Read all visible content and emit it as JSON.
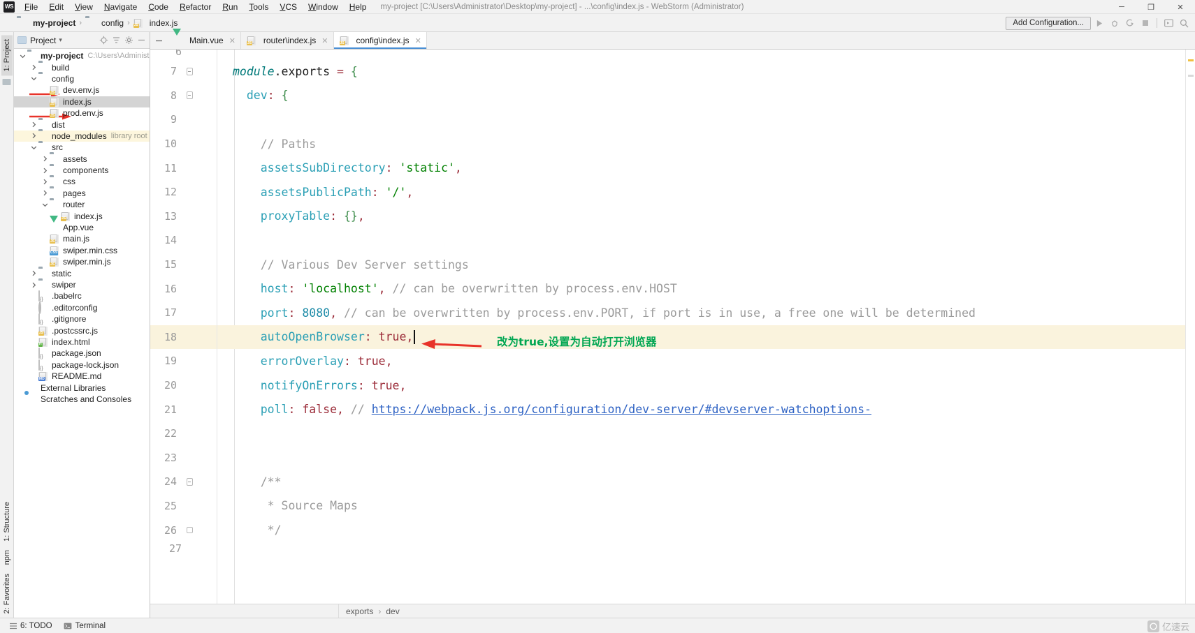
{
  "window": {
    "title": "my-project [C:\\Users\\Administrator\\Desktop\\my-project] - ...\\config\\index.js - WebStorm (Administrator)",
    "logo": "WS",
    "minimize": "─",
    "maximize": "❐",
    "close": "✕"
  },
  "menu": {
    "items": [
      "File",
      "Edit",
      "View",
      "Navigate",
      "Code",
      "Refactor",
      "Run",
      "Tools",
      "VCS",
      "Window",
      "Help"
    ]
  },
  "breadcrumb": {
    "items": [
      {
        "label": "my-project",
        "icon": "folder-icon",
        "bold": true
      },
      {
        "label": "config",
        "icon": "folder-icon",
        "bold": false
      },
      {
        "label": "index.js",
        "icon": "js-file-icon",
        "bold": false
      }
    ],
    "separator": "›"
  },
  "toolbar": {
    "add_configuration": "Add Configuration...",
    "icons": [
      "run-icon",
      "debug-icon",
      "run-coverage-icon",
      "stop-icon",
      "updates-icon",
      "search-icon"
    ]
  },
  "left_strip": {
    "top_tabs": [
      {
        "label": "1: Project",
        "icon": "project-icon",
        "active": true
      }
    ],
    "bottom_tabs": [
      {
        "label": "1: Structure",
        "icon": "structure-icon"
      },
      {
        "label": "npm",
        "icon": "npm-icon"
      },
      {
        "label": "2: Favorites",
        "icon": "favorites-icon"
      }
    ]
  },
  "project_panel": {
    "title": "Project",
    "dropdown": "▾",
    "header_icons": [
      "locate-icon",
      "collapse-all-icon",
      "settings-gear-icon",
      "hide-icon"
    ],
    "tree": [
      {
        "depth": 0,
        "twisty": "expanded",
        "icon": "folder-icon",
        "label": "my-project",
        "bold": true,
        "sub": "C:\\Users\\Administrato",
        "selected": false
      },
      {
        "depth": 1,
        "twisty": "collapsed",
        "icon": "folder-icon",
        "label": "build",
        "bold": false,
        "sub": "",
        "selected": false
      },
      {
        "depth": 1,
        "twisty": "expanded",
        "icon": "folder-icon",
        "label": "config",
        "bold": false,
        "sub": "",
        "selected": false,
        "arrow": true
      },
      {
        "depth": 2,
        "twisty": "none",
        "icon": "js-file-icon",
        "label": "dev.env.js",
        "bold": false,
        "sub": "",
        "selected": false
      },
      {
        "depth": 2,
        "twisty": "none",
        "icon": "js-file-icon",
        "label": "index.js",
        "bold": false,
        "sub": "",
        "selected": true,
        "arrow": true
      },
      {
        "depth": 2,
        "twisty": "none",
        "icon": "js-file-icon",
        "label": "prod.env.js",
        "bold": false,
        "sub": "",
        "selected": false
      },
      {
        "depth": 1,
        "twisty": "collapsed",
        "icon": "folder-icon",
        "label": "dist",
        "bold": false,
        "sub": "",
        "selected": false
      },
      {
        "depth": 1,
        "twisty": "collapsed",
        "icon": "folder-icon",
        "label": "node_modules",
        "bold": false,
        "sub": "library root",
        "selected": false,
        "library": true
      },
      {
        "depth": 1,
        "twisty": "expanded",
        "icon": "folder-icon",
        "label": "src",
        "bold": false,
        "sub": "",
        "selected": false
      },
      {
        "depth": 2,
        "twisty": "collapsed",
        "icon": "folder-icon",
        "label": "assets",
        "bold": false,
        "sub": "",
        "selected": false
      },
      {
        "depth": 2,
        "twisty": "collapsed",
        "icon": "folder-icon",
        "label": "components",
        "bold": false,
        "sub": "",
        "selected": false
      },
      {
        "depth": 2,
        "twisty": "collapsed",
        "icon": "folder-icon",
        "label": "css",
        "bold": false,
        "sub": "",
        "selected": false
      },
      {
        "depth": 2,
        "twisty": "collapsed",
        "icon": "folder-icon",
        "label": "pages",
        "bold": false,
        "sub": "",
        "selected": false
      },
      {
        "depth": 2,
        "twisty": "expanded",
        "icon": "folder-icon",
        "label": "router",
        "bold": false,
        "sub": "",
        "selected": false
      },
      {
        "depth": 3,
        "twisty": "none",
        "icon": "js-file-icon",
        "label": "index.js",
        "bold": false,
        "sub": "",
        "selected": false
      },
      {
        "depth": 2,
        "twisty": "none",
        "icon": "vue-file-icon",
        "label": "App.vue",
        "bold": false,
        "sub": "",
        "selected": false
      },
      {
        "depth": 2,
        "twisty": "none",
        "icon": "js-file-icon",
        "label": "main.js",
        "bold": false,
        "sub": "",
        "selected": false
      },
      {
        "depth": 2,
        "twisty": "none",
        "icon": "css-file-icon",
        "label": "swiper.min.css",
        "bold": false,
        "sub": "",
        "selected": false
      },
      {
        "depth": 2,
        "twisty": "none",
        "icon": "js-file-icon",
        "label": "swiper.min.js",
        "bold": false,
        "sub": "",
        "selected": false
      },
      {
        "depth": 1,
        "twisty": "collapsed",
        "icon": "folder-icon",
        "label": "static",
        "bold": false,
        "sub": "",
        "selected": false
      },
      {
        "depth": 1,
        "twisty": "collapsed",
        "icon": "folder-icon",
        "label": "swiper",
        "bold": false,
        "sub": "",
        "selected": false
      },
      {
        "depth": 1,
        "twisty": "none",
        "icon": "json-file-icon",
        "label": ".babelrc",
        "bold": false,
        "sub": "",
        "selected": false
      },
      {
        "depth": 1,
        "twisty": "none",
        "icon": "gear-file-icon",
        "label": ".editorconfig",
        "bold": false,
        "sub": "",
        "selected": false
      },
      {
        "depth": 1,
        "twisty": "none",
        "icon": "json-file-icon",
        "label": ".gitignore",
        "bold": false,
        "sub": "",
        "selected": false
      },
      {
        "depth": 1,
        "twisty": "none",
        "icon": "js-file-icon",
        "label": ".postcssrc.js",
        "bold": false,
        "sub": "",
        "selected": false
      },
      {
        "depth": 1,
        "twisty": "none",
        "icon": "html-file-icon",
        "label": "index.html",
        "bold": false,
        "sub": "",
        "selected": false
      },
      {
        "depth": 1,
        "twisty": "none",
        "icon": "json-file-icon",
        "label": "package.json",
        "bold": false,
        "sub": "",
        "selected": false
      },
      {
        "depth": 1,
        "twisty": "none",
        "icon": "json-file-icon",
        "label": "package-lock.json",
        "bold": false,
        "sub": "",
        "selected": false
      },
      {
        "depth": 1,
        "twisty": "none",
        "icon": "md-file-icon",
        "label": "README.md",
        "bold": false,
        "sub": "",
        "selected": false
      },
      {
        "depth": 0,
        "twisty": "none",
        "icon": "external-libraries-icon",
        "label": "External Libraries",
        "bold": false,
        "sub": "",
        "selected": false
      },
      {
        "depth": 0,
        "twisty": "none",
        "icon": "scratches-icon",
        "label": "Scratches and Consoles",
        "bold": false,
        "sub": "",
        "selected": false
      }
    ]
  },
  "editor": {
    "tabs": [
      {
        "label": "Main.vue",
        "icon": "vue-file-icon",
        "active": false,
        "close": "✕"
      },
      {
        "label": "router\\index.js",
        "icon": "js-file-icon",
        "active": false,
        "close": "✕"
      },
      {
        "label": "config\\index.js",
        "icon": "js-file-icon",
        "active": true,
        "close": "✕"
      }
    ],
    "partial_top_line": "6",
    "partial_bottom_line": "27",
    "lines": [
      {
        "num": "7",
        "fold": "start",
        "highlight": false,
        "tokens": [
          {
            "t": "module",
            "c": "t-italic"
          },
          {
            "t": ".",
            "c": "t-plain"
          },
          {
            "t": "exports",
            "c": "t-plain"
          },
          {
            "t": " ",
            "c": "t-plain"
          },
          {
            "t": "=",
            "c": "t-eq"
          },
          {
            "t": " ",
            "c": "t-plain"
          },
          {
            "t": "{",
            "c": "t-brace"
          }
        ]
      },
      {
        "num": "8",
        "fold": "start",
        "highlight": false,
        "indent": 1,
        "tokens": [
          {
            "t": "  ",
            "c": "t-plain"
          },
          {
            "t": "dev",
            "c": "t-prop"
          },
          {
            "t": ":",
            "c": "t-punc"
          },
          {
            "t": " ",
            "c": "t-plain"
          },
          {
            "t": "{",
            "c": "t-brace"
          }
        ]
      },
      {
        "num": "9",
        "fold": "none",
        "highlight": false,
        "indent": 1,
        "tokens": []
      },
      {
        "num": "10",
        "fold": "none",
        "highlight": false,
        "indent": 1,
        "tokens": [
          {
            "t": "    // Paths",
            "c": "t-com"
          }
        ]
      },
      {
        "num": "11",
        "fold": "none",
        "highlight": false,
        "indent": 1,
        "tokens": [
          {
            "t": "    ",
            "c": "t-plain"
          },
          {
            "t": "assetsSubDirectory",
            "c": "t-prop"
          },
          {
            "t": ":",
            "c": "t-punc"
          },
          {
            "t": " ",
            "c": "t-plain"
          },
          {
            "t": "'static'",
            "c": "t-str"
          },
          {
            "t": ",",
            "c": "t-punc"
          }
        ]
      },
      {
        "num": "12",
        "fold": "none",
        "highlight": false,
        "indent": 1,
        "tokens": [
          {
            "t": "    ",
            "c": "t-plain"
          },
          {
            "t": "assetsPublicPath",
            "c": "t-prop"
          },
          {
            "t": ":",
            "c": "t-punc"
          },
          {
            "t": " ",
            "c": "t-plain"
          },
          {
            "t": "'/'",
            "c": "t-str"
          },
          {
            "t": ",",
            "c": "t-punc"
          }
        ]
      },
      {
        "num": "13",
        "fold": "none",
        "highlight": false,
        "indent": 1,
        "tokens": [
          {
            "t": "    ",
            "c": "t-plain"
          },
          {
            "t": "proxyTable",
            "c": "t-prop"
          },
          {
            "t": ":",
            "c": "t-punc"
          },
          {
            "t": " ",
            "c": "t-plain"
          },
          {
            "t": "{}",
            "c": "t-brace"
          },
          {
            "t": ",",
            "c": "t-punc"
          }
        ]
      },
      {
        "num": "14",
        "fold": "none",
        "highlight": false,
        "indent": 1,
        "tokens": []
      },
      {
        "num": "15",
        "fold": "none",
        "highlight": false,
        "indent": 1,
        "tokens": [
          {
            "t": "    // Various Dev Server settings",
            "c": "t-com"
          }
        ]
      },
      {
        "num": "16",
        "fold": "none",
        "highlight": false,
        "indent": 1,
        "tokens": [
          {
            "t": "    ",
            "c": "t-plain"
          },
          {
            "t": "host",
            "c": "t-prop"
          },
          {
            "t": ":",
            "c": "t-punc"
          },
          {
            "t": " ",
            "c": "t-plain"
          },
          {
            "t": "'localhost'",
            "c": "t-str"
          },
          {
            "t": ",",
            "c": "t-punc"
          },
          {
            "t": " // can be overwritten by process.env.HOST",
            "c": "t-com"
          }
        ]
      },
      {
        "num": "17",
        "fold": "none",
        "highlight": false,
        "indent": 1,
        "tokens": [
          {
            "t": "    ",
            "c": "t-plain"
          },
          {
            "t": "port",
            "c": "t-prop"
          },
          {
            "t": ":",
            "c": "t-punc"
          },
          {
            "t": " ",
            "c": "t-plain"
          },
          {
            "t": "8080",
            "c": "t-num"
          },
          {
            "t": ",",
            "c": "t-punc"
          },
          {
            "t": " // can be overwritten by process.env.PORT, if port is in use, a free one will be determined",
            "c": "t-com"
          }
        ]
      },
      {
        "num": "18",
        "fold": "none",
        "highlight": true,
        "indent": 1,
        "caret": true,
        "tokens": [
          {
            "t": "    ",
            "c": "t-plain"
          },
          {
            "t": "autoOpenBrowser",
            "c": "t-prop"
          },
          {
            "t": ":",
            "c": "t-punc"
          },
          {
            "t": " ",
            "c": "t-plain"
          },
          {
            "t": "true",
            "c": "t-bool"
          },
          {
            "t": ",",
            "c": "t-punc"
          }
        ]
      },
      {
        "num": "19",
        "fold": "none",
        "highlight": false,
        "indent": 1,
        "tokens": [
          {
            "t": "    ",
            "c": "t-plain"
          },
          {
            "t": "errorOverlay",
            "c": "t-prop"
          },
          {
            "t": ":",
            "c": "t-punc"
          },
          {
            "t": " ",
            "c": "t-plain"
          },
          {
            "t": "true",
            "c": "t-bool"
          },
          {
            "t": ",",
            "c": "t-punc"
          }
        ]
      },
      {
        "num": "20",
        "fold": "none",
        "highlight": false,
        "indent": 1,
        "tokens": [
          {
            "t": "    ",
            "c": "t-plain"
          },
          {
            "t": "notifyOnErrors",
            "c": "t-prop"
          },
          {
            "t": ":",
            "c": "t-punc"
          },
          {
            "t": " ",
            "c": "t-plain"
          },
          {
            "t": "true",
            "c": "t-bool"
          },
          {
            "t": ",",
            "c": "t-punc"
          }
        ]
      },
      {
        "num": "21",
        "fold": "none",
        "highlight": false,
        "indent": 1,
        "tokens": [
          {
            "t": "    ",
            "c": "t-plain"
          },
          {
            "t": "poll",
            "c": "t-prop"
          },
          {
            "t": ":",
            "c": "t-punc"
          },
          {
            "t": " ",
            "c": "t-plain"
          },
          {
            "t": "false",
            "c": "t-bool"
          },
          {
            "t": ",",
            "c": "t-punc"
          },
          {
            "t": " // ",
            "c": "t-com"
          },
          {
            "t": "https://webpack.js.org/configuration/dev-server/#devserver-watchoptions-",
            "c": "t-link"
          }
        ]
      },
      {
        "num": "22",
        "fold": "none",
        "highlight": false,
        "indent": 1,
        "tokens": []
      },
      {
        "num": "23",
        "fold": "none",
        "highlight": false,
        "indent": 1,
        "tokens": []
      },
      {
        "num": "24",
        "fold": "start",
        "highlight": false,
        "indent": 1,
        "tokens": [
          {
            "t": "    /**",
            "c": "t-com"
          }
        ]
      },
      {
        "num": "25",
        "fold": "none",
        "highlight": false,
        "indent": 1,
        "tokens": [
          {
            "t": "     * Source Maps",
            "c": "t-com"
          }
        ]
      },
      {
        "num": "26",
        "fold": "end",
        "highlight": false,
        "indent": 1,
        "tokens": [
          {
            "t": "     */",
            "c": "t-com"
          }
        ]
      }
    ],
    "annotation": {
      "text": "改为true,设置为自动打开浏览器",
      "color": "#00a652",
      "arrow_color": "#e8332a"
    }
  },
  "footer_breadcrumb": {
    "items": [
      "exports",
      "dev"
    ],
    "separator": "›"
  },
  "statusbar": {
    "items": [
      {
        "label": "6: TODO",
        "icon": "todo-icon"
      },
      {
        "label": "Terminal",
        "icon": "terminal-icon"
      }
    ],
    "watermark": "亿速云"
  },
  "colors": {
    "accent": "#4a8fd4",
    "highlight_line": "#faf3dd",
    "selection": "#d4d4d4",
    "library_row": "#fdf6dd",
    "annotation_green": "#00a652",
    "annotation_red": "#e8332a"
  }
}
